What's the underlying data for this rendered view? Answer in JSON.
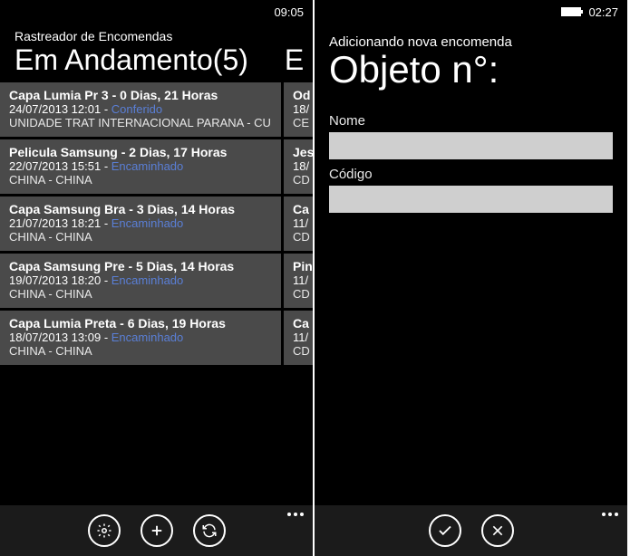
{
  "left": {
    "statusbar": {
      "time": "09:05"
    },
    "app_title": "Rastreador de Encomendas",
    "pivot_title": "Em Andamento(5)",
    "pivot_next": "E",
    "items": [
      {
        "title": "Capa Lumia Pr 3 - 0 Dias, 21 Horas",
        "datetime": "24/07/2013 12:01",
        "status": "Conferido",
        "location": "UNIDADE TRAT INTERNACIONAL PARANA - CU",
        "peek_title": "Od",
        "peek_date": "18/",
        "peek_loc": "CE"
      },
      {
        "title": "Pelicula Samsung - 2 Dias, 17 Horas",
        "datetime": "22/07/2013 15:51",
        "status": "Encaminhado",
        "location": "CHINA - CHINA",
        "peek_title": "Jes",
        "peek_date": "18/",
        "peek_loc": "CD"
      },
      {
        "title": "Capa Samsung Bra - 3 Dias, 14 Horas",
        "datetime": "21/07/2013 18:21",
        "status": "Encaminhado",
        "location": "CHINA - CHINA",
        "peek_title": "Ca",
        "peek_date": "11/",
        "peek_loc": "CD"
      },
      {
        "title": "Capa Samsung Pre - 5 Dias, 14 Horas",
        "datetime": "19/07/2013 18:20",
        "status": "Encaminhado",
        "location": "CHINA - CHINA",
        "peek_title": "Pin",
        "peek_date": "11/",
        "peek_loc": "CD"
      },
      {
        "title": "Capa Lumia Preta - 6 Dias, 19 Horas",
        "datetime": "18/07/2013 13:09",
        "status": "Encaminhado",
        "location": "CHINA - CHINA",
        "peek_title": "Ca",
        "peek_date": "11/",
        "peek_loc": "CD"
      }
    ]
  },
  "right": {
    "statusbar": {
      "time": "02:27"
    },
    "page_sub": "Adicionando nova encomenda",
    "page_title": "Objeto n°:",
    "form": {
      "name_label": "Nome",
      "code_label": "Código",
      "name_value": "",
      "code_value": ""
    }
  }
}
